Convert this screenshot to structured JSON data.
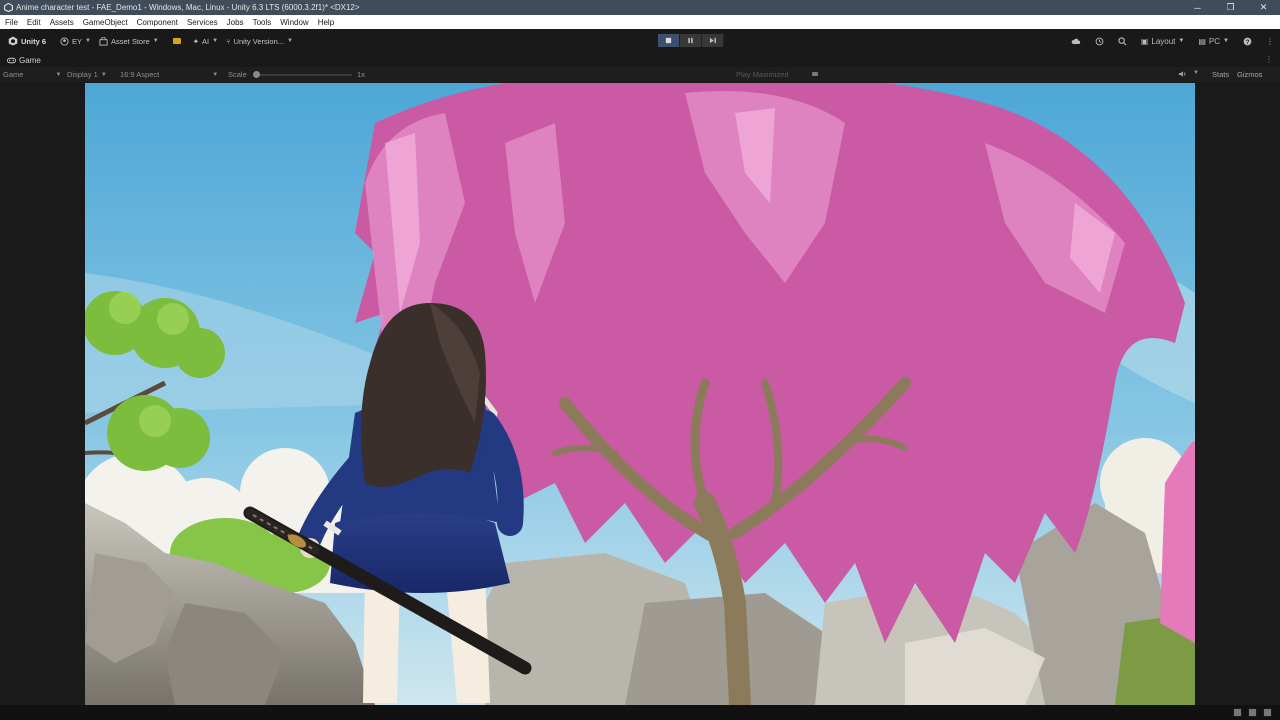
{
  "window": {
    "title": "Anime character test - FAE_Demo1 - Windows, Mac, Linux - Unity 6.3 LTS (6000.3.2f1)* <DX12>",
    "controls": {
      "minimize": "─",
      "restore": "❐",
      "close": "✕"
    }
  },
  "menu": {
    "items": [
      "File",
      "Edit",
      "Assets",
      "GameObject",
      "Component",
      "Services",
      "Jobs",
      "Tools",
      "Window",
      "Help"
    ]
  },
  "toolbar": {
    "unity_label": "Unity 6",
    "account_label": "EY",
    "asset_store_label": "Asset Store",
    "ai_label": "AI",
    "version_control_label": "Unity Version...",
    "layout_label": "Layout",
    "platform_label": "PC"
  },
  "tab": {
    "label": "Game",
    "menu_glyph": "⋮"
  },
  "game_view": {
    "mode": "Game",
    "display": "Display 1",
    "aspect": "16:9 Aspect",
    "scale_label": "Scale",
    "scale_value": "1x",
    "play_mode": "Play Maximized",
    "stats_label": "Stats",
    "gizmos_label": "Gizmos"
  },
  "icons": {
    "unity": "unity-logo-icon",
    "account": "account-icon",
    "store": "asset-store-icon",
    "ai": "ai-sparkle-icon",
    "vcs": "version-control-icon",
    "play": "play-icon",
    "pause": "pause-icon",
    "step": "step-icon",
    "cloud": "cloud-icon",
    "history": "history-icon",
    "search": "search-icon",
    "help": "help-icon",
    "more": "more-icon",
    "audio": "audio-icon"
  },
  "colors": {
    "titlebar": "#414c5a",
    "editor_bg": "#191919",
    "play_active": "#3d4f6e",
    "sky": "#5fb4d8",
    "blossom": "#d65fa8"
  }
}
